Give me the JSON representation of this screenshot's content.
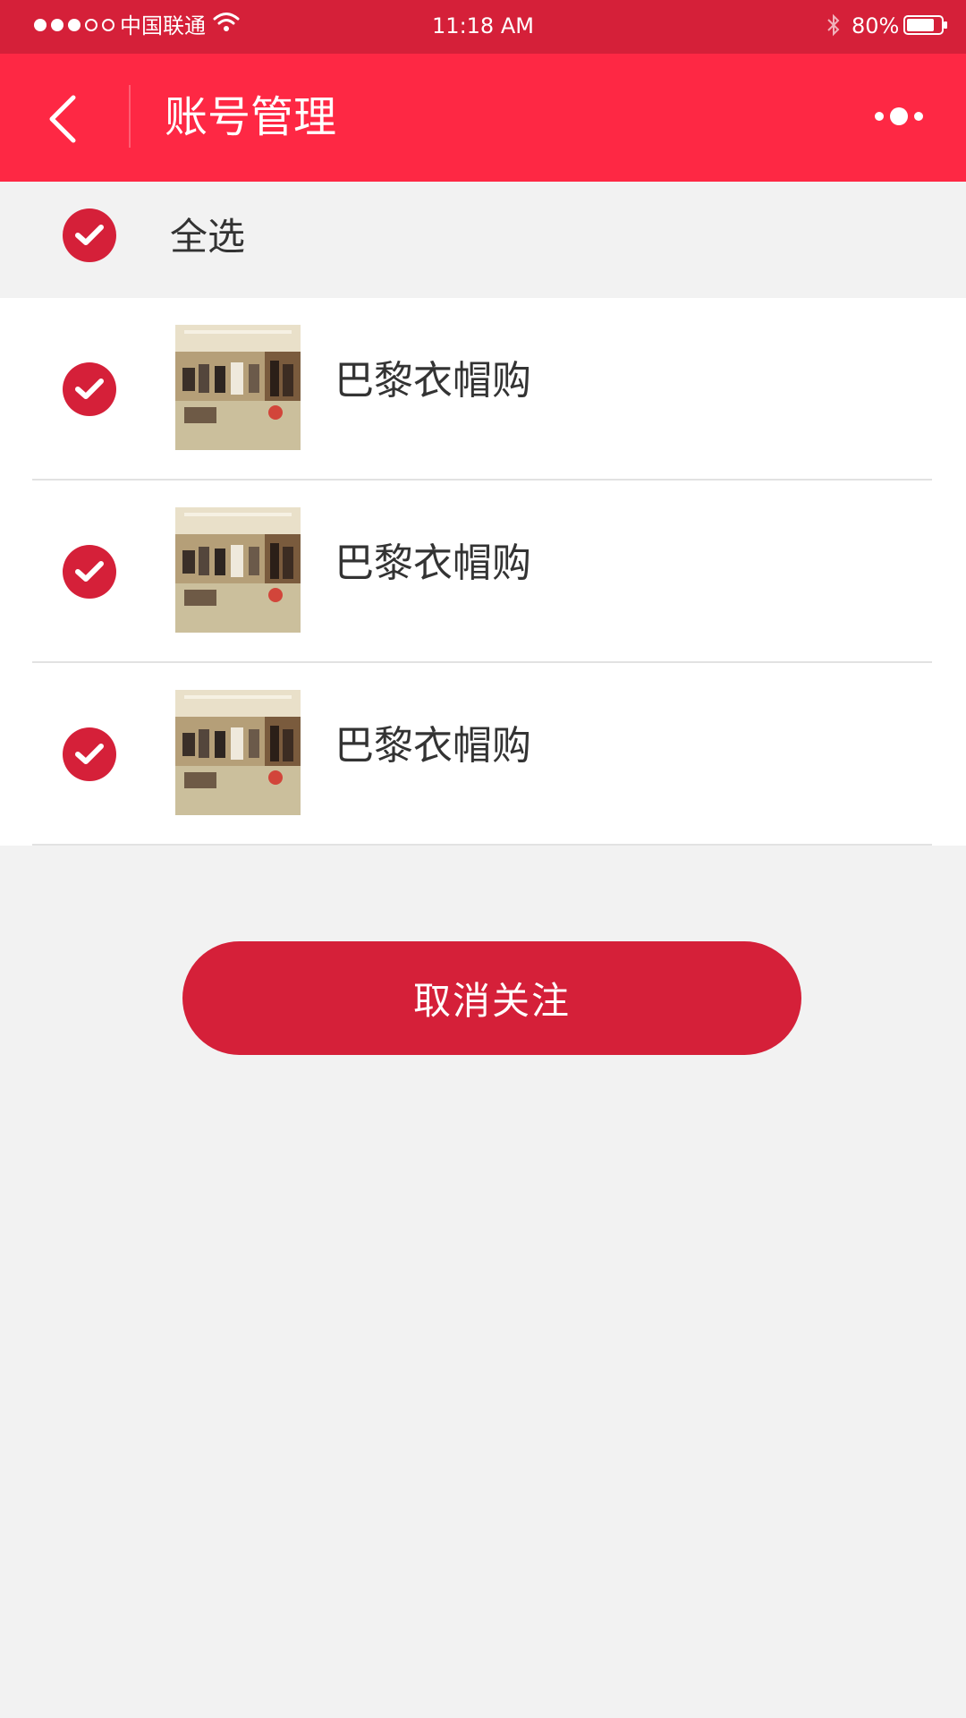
{
  "status_bar": {
    "carrier": "中国联通",
    "time": "11:18 AM",
    "battery": "80%",
    "signal_bars_filled": 3,
    "signal_bars_total": 5,
    "battery_level": 0.8
  },
  "header": {
    "title": "账号管理",
    "back_icon": "chevron-left-icon",
    "more_icon": "more-dots-icon"
  },
  "select_all": {
    "label": "全选",
    "checked": true
  },
  "accounts": [
    {
      "name": "巴黎衣帽购",
      "checked": true
    },
    {
      "name": "巴黎衣帽购",
      "checked": true
    },
    {
      "name": "巴黎衣帽购",
      "checked": true
    }
  ],
  "actions": {
    "unfollow_label": "取消关注"
  },
  "colors": {
    "status_bar": "#d52039",
    "header": "#fe2844",
    "accent": "#d52039",
    "background": "#f2f2f2"
  }
}
